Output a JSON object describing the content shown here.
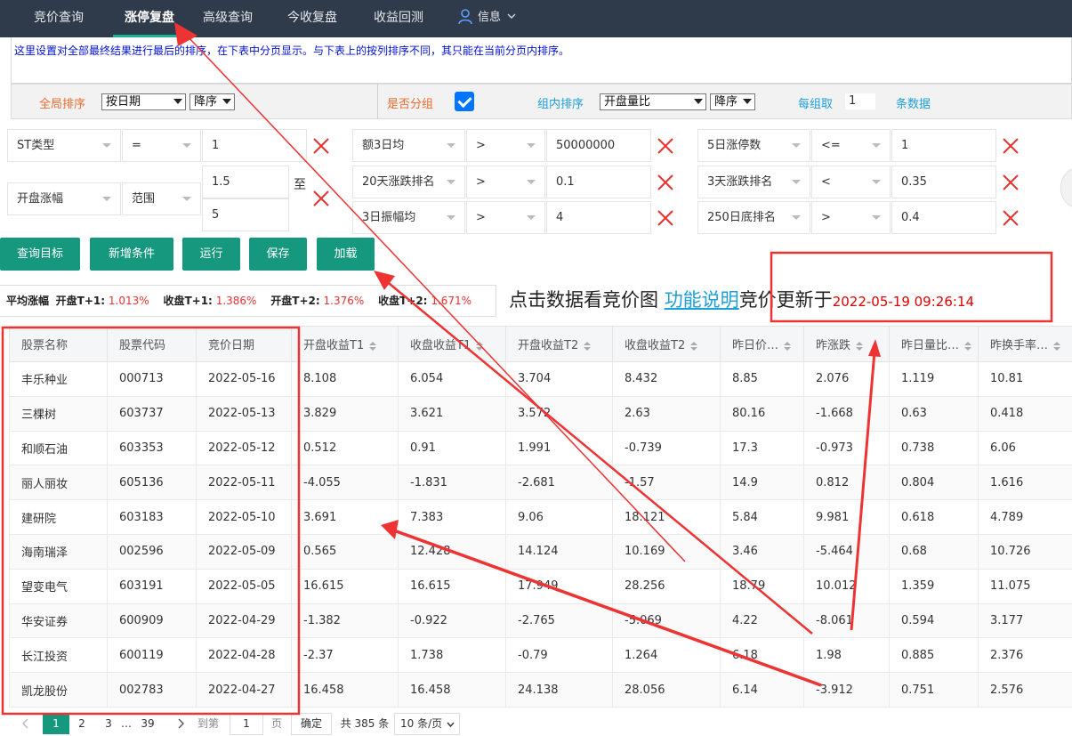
{
  "nav": {
    "tabs": [
      {
        "label": "竞价查询"
      },
      {
        "label": "涨停复盘"
      },
      {
        "label": "高级查询"
      },
      {
        "label": "今收复盘"
      },
      {
        "label": "收益回测"
      },
      {
        "label": "信息"
      }
    ],
    "active_tab": "涨停复盘"
  },
  "notice": "这里设置对全部最终结果进行最后的排序，在下表中分页显示。与下表上的按列排序不同，其只能在当前分页内排序。",
  "sort_bar": {
    "global_sort_label": "全局排序",
    "global_sort_field": "按日期",
    "global_sort_order": "降序",
    "group_label": "是否分组",
    "group_checked": true,
    "group_sort_label": "组内排序",
    "group_sort_field": "开盘量比",
    "group_sort_order": "降序",
    "per_group_label": "每组取",
    "per_group_value": "1",
    "per_group_unit": "条数据"
  },
  "conditions": [
    {
      "field": "ST类型",
      "op": "=",
      "value": "1"
    },
    {
      "field": "开盘涨幅",
      "op": "范围",
      "value_from": "1.5",
      "range_sep": "至",
      "value_to": "5"
    },
    {
      "field": "额3日均",
      "op": ">",
      "value": "50000000"
    },
    {
      "field": "20天涨跌排名",
      "op": ">",
      "value": "0.1"
    },
    {
      "field": "3日振幅均",
      "op": ">",
      "value": "4"
    },
    {
      "field": "5日涨停数",
      "op": "<=",
      "value": "1"
    },
    {
      "field": "3天涨跌排名",
      "op": "<",
      "value": "0.35"
    },
    {
      "field": "250日底排名",
      "op": ">",
      "value": "0.4"
    }
  ],
  "buttons": {
    "query_target": "查询目标",
    "add_condition": "新增条件",
    "run": "运行",
    "save": "保存",
    "load": "加载"
  },
  "avg": {
    "label": "平均涨幅",
    "items": [
      {
        "k": "开盘T+1:",
        "v": "1.013%"
      },
      {
        "k": "收盘T+1:",
        "v": "1.386%"
      },
      {
        "k": "开盘T+2:",
        "v": "1.376%"
      },
      {
        "k": "收盘T+2:",
        "v": "1.671%"
      }
    ]
  },
  "hint": {
    "prefix": "点击数据看竞价图",
    "link": "功能说明",
    "suffix": "竞价更新于",
    "timestamp": "2022-05-19 09:26:14"
  },
  "table": {
    "columns": [
      "股票名称",
      "股票代码",
      "竞价日期",
      "开盘收益T1",
      "收盘收益T1",
      "开盘收益T2",
      "收盘收益T2",
      "昨日价…",
      "昨涨跌",
      "昨日量比…",
      "昨换手率…"
    ],
    "rows": [
      [
        "丰乐种业",
        "000713",
        "2022-05-16",
        "8.108",
        "6.054",
        "3.704",
        "8.432",
        "8.85",
        "2.076",
        "1.119",
        "10.81"
      ],
      [
        "三棵树",
        "603737",
        "2022-05-13",
        "3.829",
        "3.621",
        "3.572",
        "2.63",
        "80.16",
        "-1.668",
        "0.63",
        "0.418"
      ],
      [
        "和顺石油",
        "603353",
        "2022-05-12",
        "0.512",
        "0.91",
        "1.991",
        "-0.739",
        "17.3",
        "-0.973",
        "0.738",
        "6.06"
      ],
      [
        "丽人丽妆",
        "605136",
        "2022-05-11",
        "-4.055",
        "-1.831",
        "-2.681",
        "-1.57",
        "14.9",
        "0.812",
        "0.804",
        "1.616"
      ],
      [
        "建研院",
        "603183",
        "2022-05-10",
        "3.691",
        "7.383",
        "9.06",
        "18.121",
        "5.84",
        "9.981",
        "0.618",
        "4.789"
      ],
      [
        "海南瑞泽",
        "002596",
        "2022-05-09",
        "0.565",
        "12.428",
        "14.124",
        "10.169",
        "3.46",
        "-5.464",
        "0.68",
        "10.726"
      ],
      [
        "望变电气",
        "603191",
        "2022-05-05",
        "16.615",
        "16.615",
        "17.949",
        "28.256",
        "18.79",
        "10.012",
        "1.359",
        "11.075"
      ],
      [
        "华安证券",
        "600909",
        "2022-04-29",
        "-1.382",
        "-0.922",
        "-2.765",
        "-5.069",
        "4.22",
        "-8.061",
        "0.594",
        "3.177"
      ],
      [
        "长江投资",
        "600119",
        "2022-04-28",
        "-2.37",
        "1.738",
        "-0.79",
        "1.264",
        "6.18",
        "1.98",
        "0.885",
        "2.376"
      ],
      [
        "凯龙股份",
        "002783",
        "2022-04-27",
        "16.458",
        "16.458",
        "24.138",
        "28.056",
        "6.14",
        "-3.912",
        "0.751",
        "2.576"
      ]
    ]
  },
  "pager": {
    "pages": [
      "1",
      "2",
      "3",
      "…",
      "39"
    ],
    "current": "1",
    "goto_label": "到第",
    "goto_value": "1",
    "page_unit": "页",
    "confirm": "确定",
    "total": "共 385 条",
    "page_size": "10 条/页"
  },
  "colors": {
    "nav_bg": "#2f3a4b",
    "accent": "#16987e",
    "annotation_red": "#ee3333",
    "link_blue": "#1e9fd8"
  }
}
